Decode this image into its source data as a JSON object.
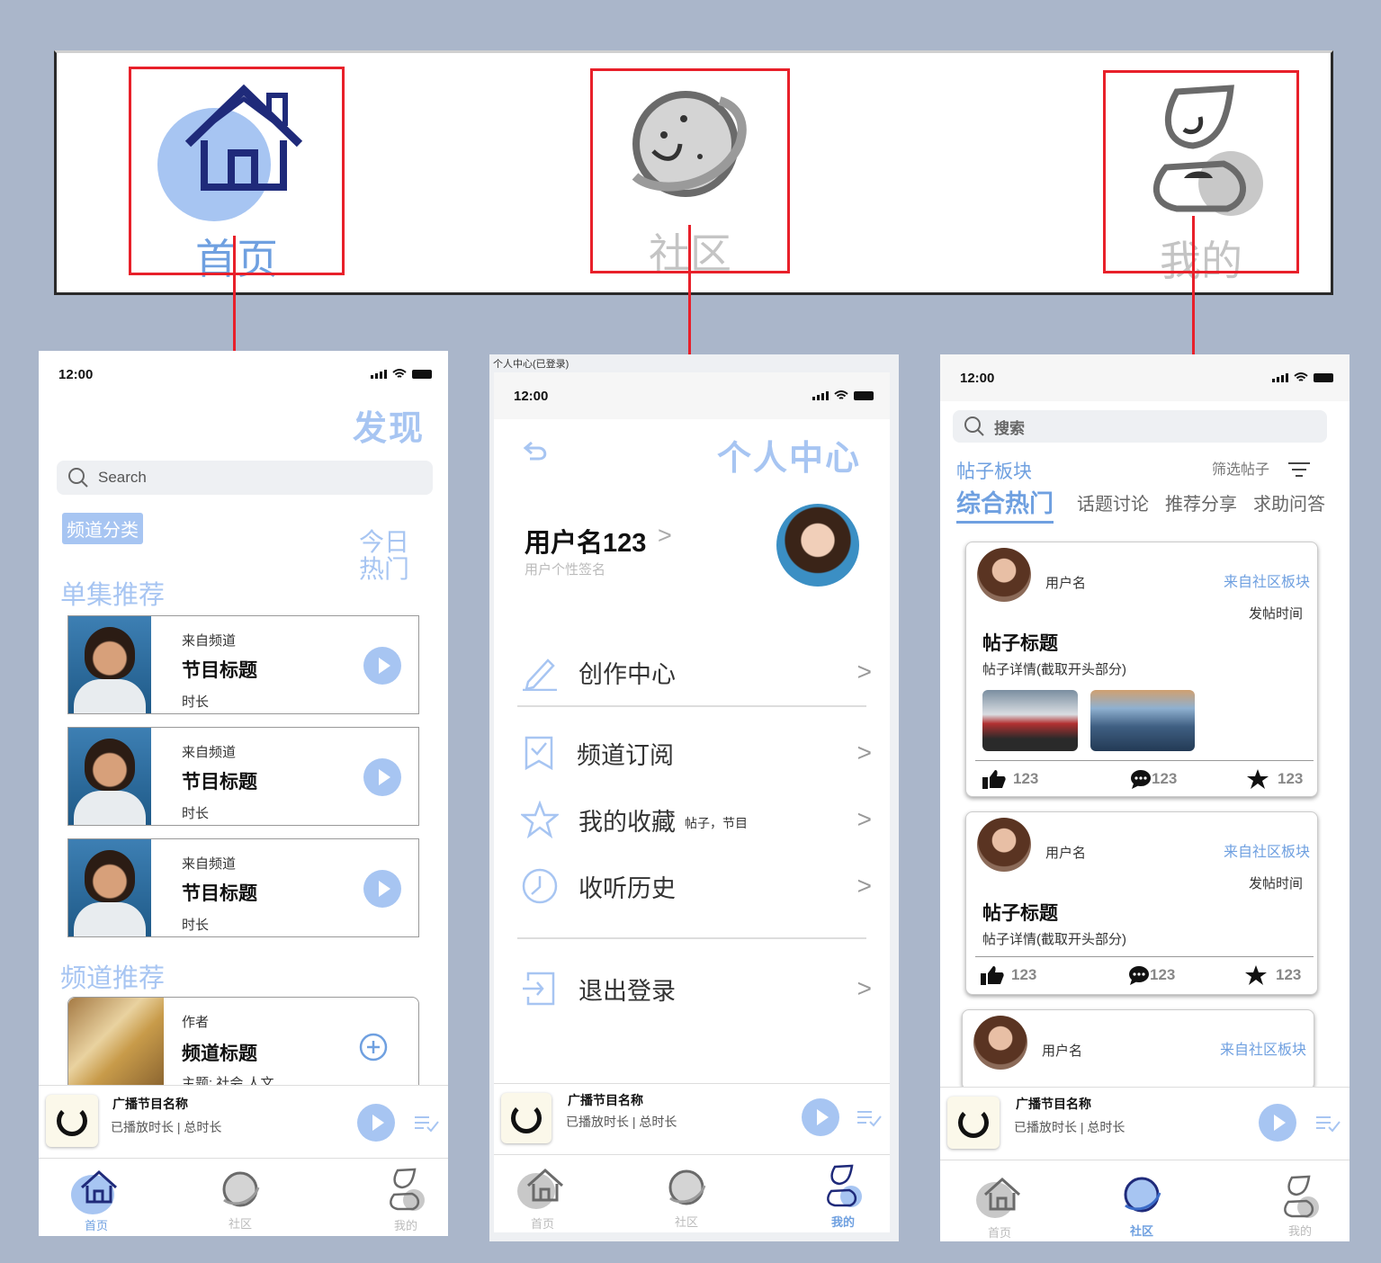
{
  "nav": {
    "home": "首页",
    "community": "社区",
    "mine": "我的"
  },
  "phone1": {
    "time": "12:00",
    "title": "发现",
    "search_placeholder": "Search",
    "channel_category": "频道分类",
    "today_hot": "今日热门",
    "episode_section": "单集推荐",
    "episodes": [
      {
        "source": "来自频道",
        "title": "节目标题",
        "duration": "时长"
      },
      {
        "source": "来自频道",
        "title": "节目标题",
        "duration": "时长"
      },
      {
        "source": "来自频道",
        "title": "节目标题",
        "duration": "时长"
      }
    ],
    "channel_section": "频道推荐",
    "channel": {
      "author": "作者",
      "title": "频道标题",
      "topic": "主题: 社会 人文"
    }
  },
  "phone2": {
    "window_caption": "个人中心(已登录)",
    "time": "12:00",
    "title": "个人中心",
    "username": "用户名123",
    "username_arrow": ">",
    "signature": "用户个性签名",
    "menu": [
      {
        "label": "创作中心",
        "sub": "",
        "arrow": ">"
      },
      {
        "label": "频道订阅",
        "sub": "",
        "arrow": ">"
      },
      {
        "label": "我的收藏",
        "sub": "帖子，节目",
        "arrow": ">"
      },
      {
        "label": "收听历史",
        "sub": "",
        "arrow": ">"
      },
      {
        "label": "退出登录",
        "sub": "",
        "arrow": ">"
      }
    ]
  },
  "phone3": {
    "time": "12:00",
    "search_placeholder": "搜索",
    "board_label": "帖子板块",
    "filter_label": "筛选帖子",
    "tabs": [
      "综合热门",
      "话题讨论",
      "推荐分享",
      "求助问答"
    ],
    "posts": [
      {
        "user": "用户名",
        "from": "来自社区板块",
        "time": "发帖时间",
        "title": "帖子标题",
        "detail": "帖子详情(截取开头部分)",
        "likes": "123",
        "comments": "123",
        "stars": "123"
      },
      {
        "user": "用户名",
        "from": "来自社区板块",
        "time": "发帖时间",
        "title": "帖子标题",
        "detail": "帖子详情(截取开头部分)",
        "likes": "123",
        "comments": "123",
        "stars": "123"
      },
      {
        "user": "用户名",
        "from": "来自社区板块"
      }
    ]
  },
  "player": {
    "name": "广播节目名称",
    "progress": "已播放时长 | 总时长"
  },
  "colors": {
    "accent": "#a7c5f2",
    "accent_text": "#6fa0e0",
    "home_icon": "#1f2a7a",
    "red": "#e8202a"
  }
}
